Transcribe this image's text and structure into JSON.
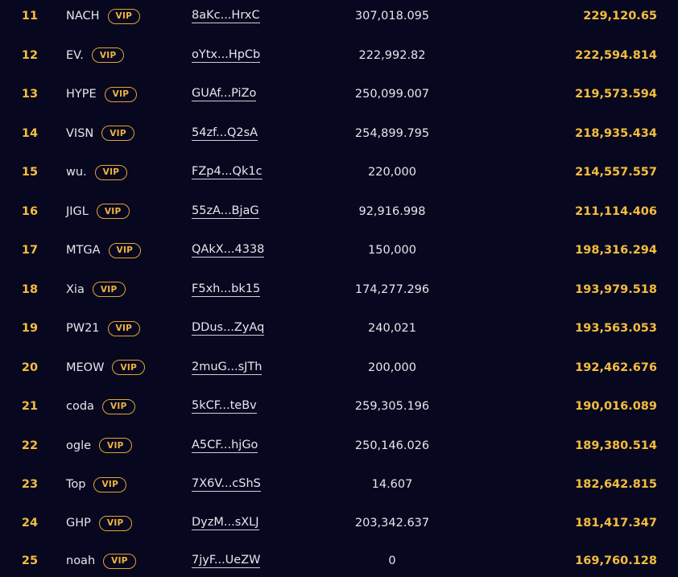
{
  "leaderboard": {
    "vip_label": "VIP",
    "rows": [
      {
        "rank": "11",
        "name": "NACH",
        "address": "8aKc...HrxC",
        "amount": "307,018.095",
        "value": "229,120.65"
      },
      {
        "rank": "12",
        "name": "EV.",
        "address": "oYtx...HpCb",
        "amount": "222,992.82",
        "value": "222,594.814"
      },
      {
        "rank": "13",
        "name": "HYPE",
        "address": "GUAf...PiZo",
        "amount": "250,099.007",
        "value": "219,573.594"
      },
      {
        "rank": "14",
        "name": "VISN",
        "address": "54zf...Q2sA",
        "amount": "254,899.795",
        "value": "218,935.434"
      },
      {
        "rank": "15",
        "name": "wu.",
        "address": "FZp4...Qk1c",
        "amount": "220,000",
        "value": "214,557.557"
      },
      {
        "rank": "16",
        "name": "JIGL",
        "address": "55zA...BjaG",
        "amount": "92,916.998",
        "value": "211,114.406"
      },
      {
        "rank": "17",
        "name": "MTGA",
        "address": "QAkX...4338",
        "amount": "150,000",
        "value": "198,316.294"
      },
      {
        "rank": "18",
        "name": "Xia",
        "address": "F5xh...bk15",
        "amount": "174,277.296",
        "value": "193,979.518"
      },
      {
        "rank": "19",
        "name": "PW21",
        "address": "DDus...ZyAq",
        "amount": "240,021",
        "value": "193,563.053"
      },
      {
        "rank": "20",
        "name": "MEOW",
        "address": "2muG...sJTh",
        "amount": "200,000",
        "value": "192,462.676"
      },
      {
        "rank": "21",
        "name": "coda",
        "address": "5kCF...teBv",
        "amount": "259,305.196",
        "value": "190,016.089"
      },
      {
        "rank": "22",
        "name": "ogle",
        "address": "A5CF...hjGo",
        "amount": "250,146.026",
        "value": "189,380.514"
      },
      {
        "rank": "23",
        "name": "Top",
        "address": "7X6V...cShS",
        "amount": "14.607",
        "value": "182,642.815"
      },
      {
        "rank": "24",
        "name": "GHP",
        "address": "DyzM...sXLJ",
        "amount": "203,342.637",
        "value": "181,417.347"
      },
      {
        "rank": "25",
        "name": "noah",
        "address": "7jyF...UeZW",
        "amount": "0",
        "value": "169,760.128"
      }
    ]
  },
  "colors": {
    "background": "#07071f",
    "accent_gold": "#f5bd3d",
    "text": "#e6e6ee"
  }
}
